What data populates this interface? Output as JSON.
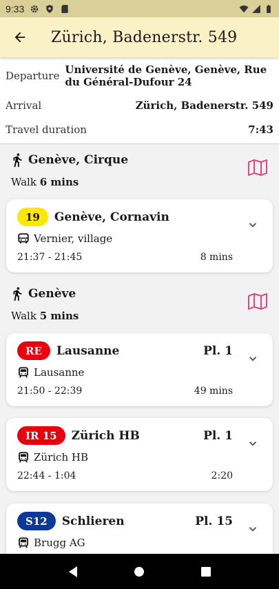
{
  "status_bar": {
    "time": "9:33",
    "icons": [
      "gear-icon",
      "shield-icon",
      "sd-card-icon"
    ],
    "right_icons": [
      "wifi-icon",
      "signal-icon",
      "battery-icon"
    ]
  },
  "app_bar": {
    "back_icon": "arrow-left-icon",
    "title": "Zürich, Badenerstr. 549"
  },
  "summary": {
    "departure_label": "Departure",
    "departure_value": "Université de Genève, Genève, Rue du Général-Dufour 24",
    "arrival_label": "Arrival",
    "arrival_value": "Zürich, Badenerstr. 549",
    "duration_label": "Travel duration",
    "duration_value": "7:43"
  },
  "legs": [
    {
      "type": "walk",
      "place": "Genève, Cirque",
      "walk_prefix": "Walk",
      "duration": "6 mins"
    },
    {
      "type": "transit",
      "badge": "19",
      "badge_color": "#ffe800",
      "destination": "Genève, Cornavin",
      "platform": "",
      "vehicle_icon": "bus-icon",
      "direction": "Vernier, village",
      "times": "21:37 - 21:45",
      "duration": "8 mins"
    },
    {
      "type": "walk",
      "place": "Genève",
      "walk_prefix": "Walk",
      "duration": "5 mins"
    },
    {
      "type": "transit",
      "badge": "RE",
      "badge_color": "#e8000d",
      "destination": "Lausanne",
      "platform": "Pl. 1",
      "vehicle_icon": "train-icon",
      "direction": "Lausanne",
      "times": "21:50 - 22:39",
      "duration": "49 mins"
    },
    {
      "type": "transit",
      "badge": "IR 15",
      "badge_color": "#e8000d",
      "destination": "Zürich HB",
      "platform": "Pl. 1",
      "vehicle_icon": "train-icon",
      "direction": "Zürich HB",
      "times": "22:44 - 1:04",
      "duration": "2:20"
    },
    {
      "type": "transit",
      "badge": "S12",
      "badge_color": "#0c3897",
      "destination": "Schlieren",
      "platform": "Pl. 15",
      "vehicle_icon": "train-icon",
      "direction": "Brugg AG",
      "times": "",
      "duration": ""
    }
  ],
  "colors": {
    "status_bar": "#d9cf97",
    "app_bar": "#fbf1c6",
    "map_icon": "#e0457b"
  },
  "nav": [
    "back-triangle-icon",
    "home-circle-icon",
    "recents-square-icon"
  ]
}
